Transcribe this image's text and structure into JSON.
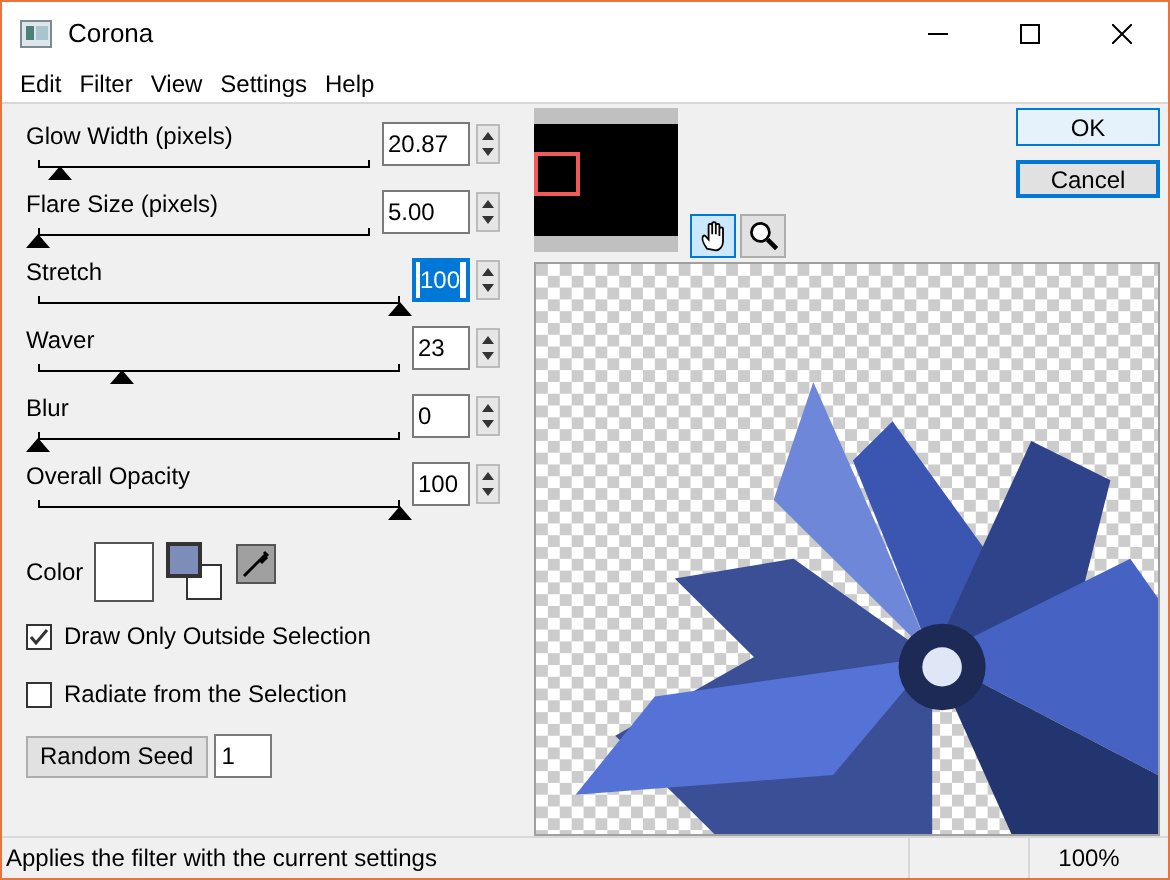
{
  "window": {
    "title": "Corona"
  },
  "menu": [
    "Edit",
    "Filter",
    "View",
    "Settings",
    "Help"
  ],
  "sliders": [
    {
      "label": "Glow Width (pixels)",
      "value": "20.87",
      "level": 0.065,
      "focused": false,
      "wide": true
    },
    {
      "label": "Flare Size (pixels)",
      "value": "5.00",
      "level": 0,
      "focused": false,
      "wide": true
    },
    {
      "label": "Stretch",
      "value": "100",
      "level": 1,
      "focused": true,
      "wide": false
    },
    {
      "label": "Waver",
      "value": "23",
      "level": 0.23,
      "focused": false,
      "wide": false
    },
    {
      "label": "Blur",
      "value": "0",
      "level": 0,
      "focused": false,
      "wide": false
    },
    {
      "label": "Overall Opacity",
      "value": "100",
      "level": 1,
      "focused": false,
      "wide": false
    }
  ],
  "color": {
    "label": "Color"
  },
  "checkboxes": [
    {
      "label": "Draw Only Outside Selection",
      "checked": true
    },
    {
      "label": "Radiate from the Selection",
      "checked": false
    }
  ],
  "random_seed": {
    "button": "Random Seed",
    "value": "1"
  },
  "tools": [
    {
      "kind": "hand",
      "selected": true
    },
    {
      "kind": "zoom",
      "selected": false
    }
  ],
  "buttons": [
    {
      "label": "OK",
      "default": true
    },
    {
      "label": "Cancel",
      "default": false
    }
  ],
  "status_bar": {
    "message": "Applies the filter with the current settings",
    "zoom": "100%"
  }
}
